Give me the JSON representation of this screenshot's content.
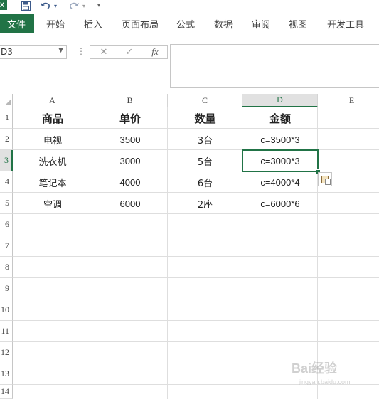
{
  "quick_access": {
    "app_icon": "excel-icon",
    "app_letter": "X",
    "save_icon": "save-icon",
    "undo_icon": "undo-icon",
    "redo_icon": "redo-icon",
    "customize_icon": "customize-qat-icon"
  },
  "ribbon": {
    "file_tab": "文件",
    "tabs": [
      "开始",
      "插入",
      "页面布局",
      "公式",
      "数据",
      "审阅",
      "视图",
      "开发工具"
    ]
  },
  "formula_bar": {
    "name_box": "D3",
    "cancel_symbol": "✕",
    "enter_symbol": "✓",
    "fx_symbol": "fx",
    "formula": ""
  },
  "sheet": {
    "columns": [
      "A",
      "B",
      "C",
      "D",
      "E"
    ],
    "rows": [
      "1",
      "2",
      "3",
      "4",
      "5",
      "6",
      "7",
      "8",
      "9",
      "10",
      "11",
      "12",
      "13",
      "14"
    ],
    "selected_cell": "D3",
    "cells": [
      [
        "商品",
        "单价",
        "数量",
        "金额"
      ],
      [
        "电视",
        "3500",
        "3台",
        "c=3500*3"
      ],
      [
        "洗衣机",
        "3000",
        "5台",
        "c=3000*3"
      ],
      [
        "笔记本",
        "4000",
        "6台",
        "c=4000*4"
      ],
      [
        "空调",
        "6000",
        "2座",
        "c=6000*6"
      ]
    ]
  },
  "accent_color": "#217346",
  "watermark": {
    "text": "Bai经验",
    "sub": "jingyan.baidu.com"
  }
}
